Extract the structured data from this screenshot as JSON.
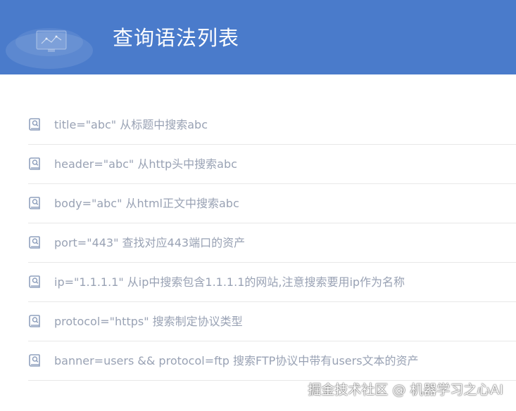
{
  "header": {
    "title": "查询语法列表"
  },
  "colors": {
    "header_bg": "#4a7bcb",
    "item_text": "#99a2b4",
    "icon": "#8fa0bd",
    "divider": "#e8e8e8"
  },
  "syntax_list": {
    "icon": "document-magnifier-icon",
    "items": [
      "title=\"abc\" 从标题中搜索abc",
      "header=\"abc\" 从http头中搜索abc",
      "body=\"abc\" 从html正文中搜索abc",
      "port=\"443\" 查找对应443端口的资产",
      "ip=\"1.1.1.1\" 从ip中搜索包含1.1.1.1的网站,注意搜索要用ip作为名称",
      "protocol=\"https\" 搜索制定协议类型",
      "banner=users && protocol=ftp 搜索FTP协议中带有users文本的资产"
    ]
  },
  "watermark": {
    "text": "掘金技术社区 @ 机器学习之心AI"
  }
}
